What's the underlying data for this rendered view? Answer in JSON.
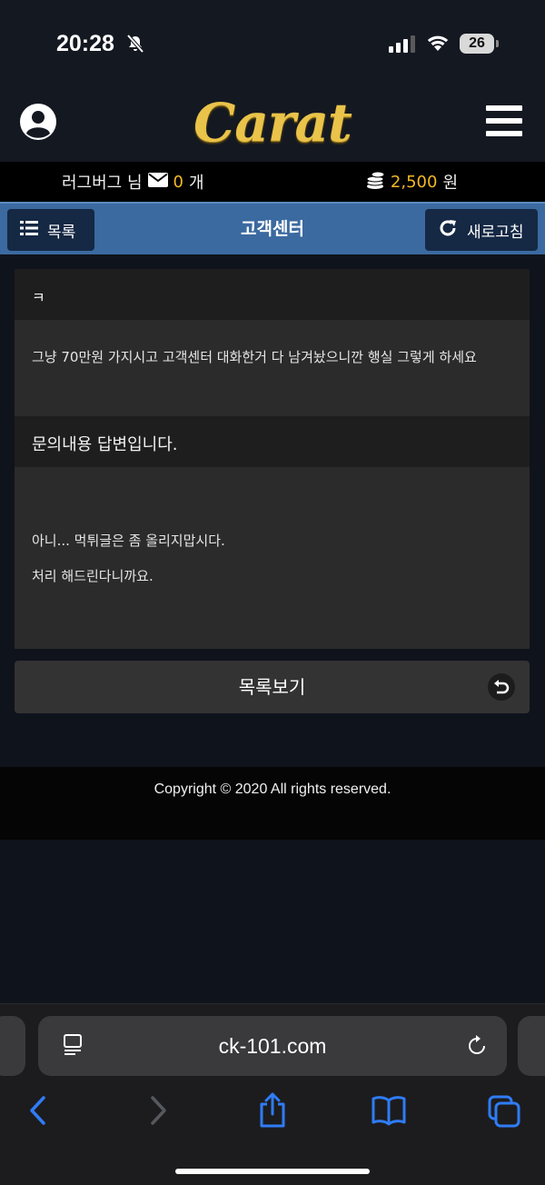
{
  "status_bar": {
    "time": "20:28",
    "battery": "26"
  },
  "header": {
    "logo": "Carat"
  },
  "user_info": {
    "username": "러그버그 님",
    "message_count": "0",
    "message_unit": "개",
    "balance": "2,500",
    "balance_unit": "원"
  },
  "nav": {
    "list_label": "목록",
    "title": "고객센터",
    "refresh_label": "새로고침"
  },
  "inquiry": {
    "title": "ㅋ",
    "body": "그냥 70만원 가지시고 고객센터 대화한거 다 남겨놨으니깐 행실 그렇게 하세요"
  },
  "answer": {
    "title": "문의내용 답변입니다.",
    "line1": "아니... 먹튀글은 좀 올리지맙시다.",
    "line2": "처리 해드린다니까요."
  },
  "list_view_button": "목록보기",
  "footer": {
    "copyright": "Copyright © 2020 All rights reserved."
  },
  "browser": {
    "url": "ck-101.com"
  },
  "colors": {
    "accent_gold": "#f2b825",
    "nav_blue": "#3b6aa0",
    "ios_blue": "#2f7cf6"
  }
}
